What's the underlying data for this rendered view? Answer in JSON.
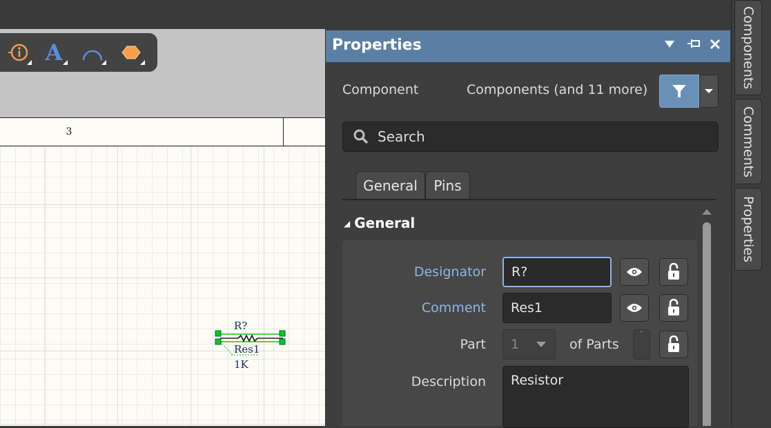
{
  "toolbar": {
    "tools": [
      {
        "name": "parameter-tool-icon",
        "color": "#f0a050"
      },
      {
        "name": "text-tool-icon",
        "glyph": "A",
        "color": "#5a8fd8"
      },
      {
        "name": "arc-tool-icon",
        "color": "#5a8fd8"
      },
      {
        "name": "port-tool-icon",
        "color": "#f0a050"
      }
    ]
  },
  "schematic": {
    "zone_label": "3",
    "component": {
      "designator": "R?",
      "comment": "Res1",
      "value": "1K"
    }
  },
  "panel": {
    "title": "Properties",
    "header_icons": [
      "dropdown-icon",
      "pin-icon",
      "close-icon"
    ],
    "object_kind": "Component",
    "filter_summary": "Components (and 11 more)",
    "search_placeholder": "Search",
    "tabs": [
      "General",
      "Pins"
    ],
    "section": "General",
    "fields": {
      "designator": {
        "label": "Designator",
        "value": "R?"
      },
      "comment": {
        "label": "Comment",
        "value": "Res1"
      },
      "part": {
        "label": "Part",
        "value": "1",
        "of_label": "of Parts",
        "count": "`"
      },
      "description": {
        "label": "Description",
        "value": "Resistor"
      }
    }
  },
  "dock_tabs": [
    "Components",
    "Comments",
    "Properties"
  ],
  "colors": {
    "header": "#5a7fa3",
    "accent_label": "#8fb6e4",
    "selection": "#12c31a"
  }
}
